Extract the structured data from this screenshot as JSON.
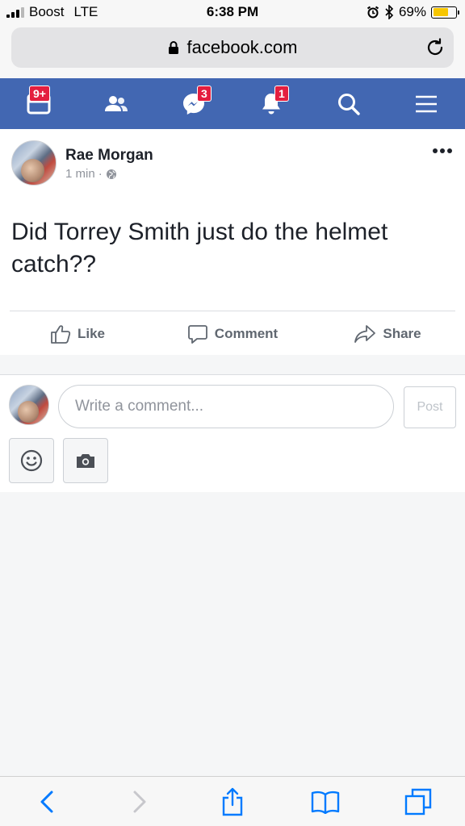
{
  "status_bar": {
    "carrier": "Boost",
    "network": "LTE",
    "time": "6:38 PM",
    "battery_percent": "69%",
    "battery_level": 0.69
  },
  "browser": {
    "url": "facebook.com"
  },
  "fb_nav": {
    "items": [
      {
        "name": "news-feed",
        "badge": "9+"
      },
      {
        "name": "friends",
        "badge": ""
      },
      {
        "name": "messenger",
        "badge": "3"
      },
      {
        "name": "notifications",
        "badge": "1"
      },
      {
        "name": "search",
        "badge": ""
      },
      {
        "name": "menu",
        "badge": ""
      }
    ],
    "color": "#4267b2"
  },
  "post": {
    "author": "Rae Morgan",
    "time": "1 min",
    "separator": "·",
    "text": "Did Torrey Smith just do the helmet catch??",
    "actions": {
      "like": "Like",
      "comment": "Comment",
      "share": "Share"
    }
  },
  "composer": {
    "placeholder": "Write a comment...",
    "post_label": "Post"
  },
  "colors": {
    "fb_blue": "#4267b2",
    "ios_blue": "#007aff",
    "badge_red": "#e41e3f",
    "battery_yellow": "#f7c600"
  }
}
